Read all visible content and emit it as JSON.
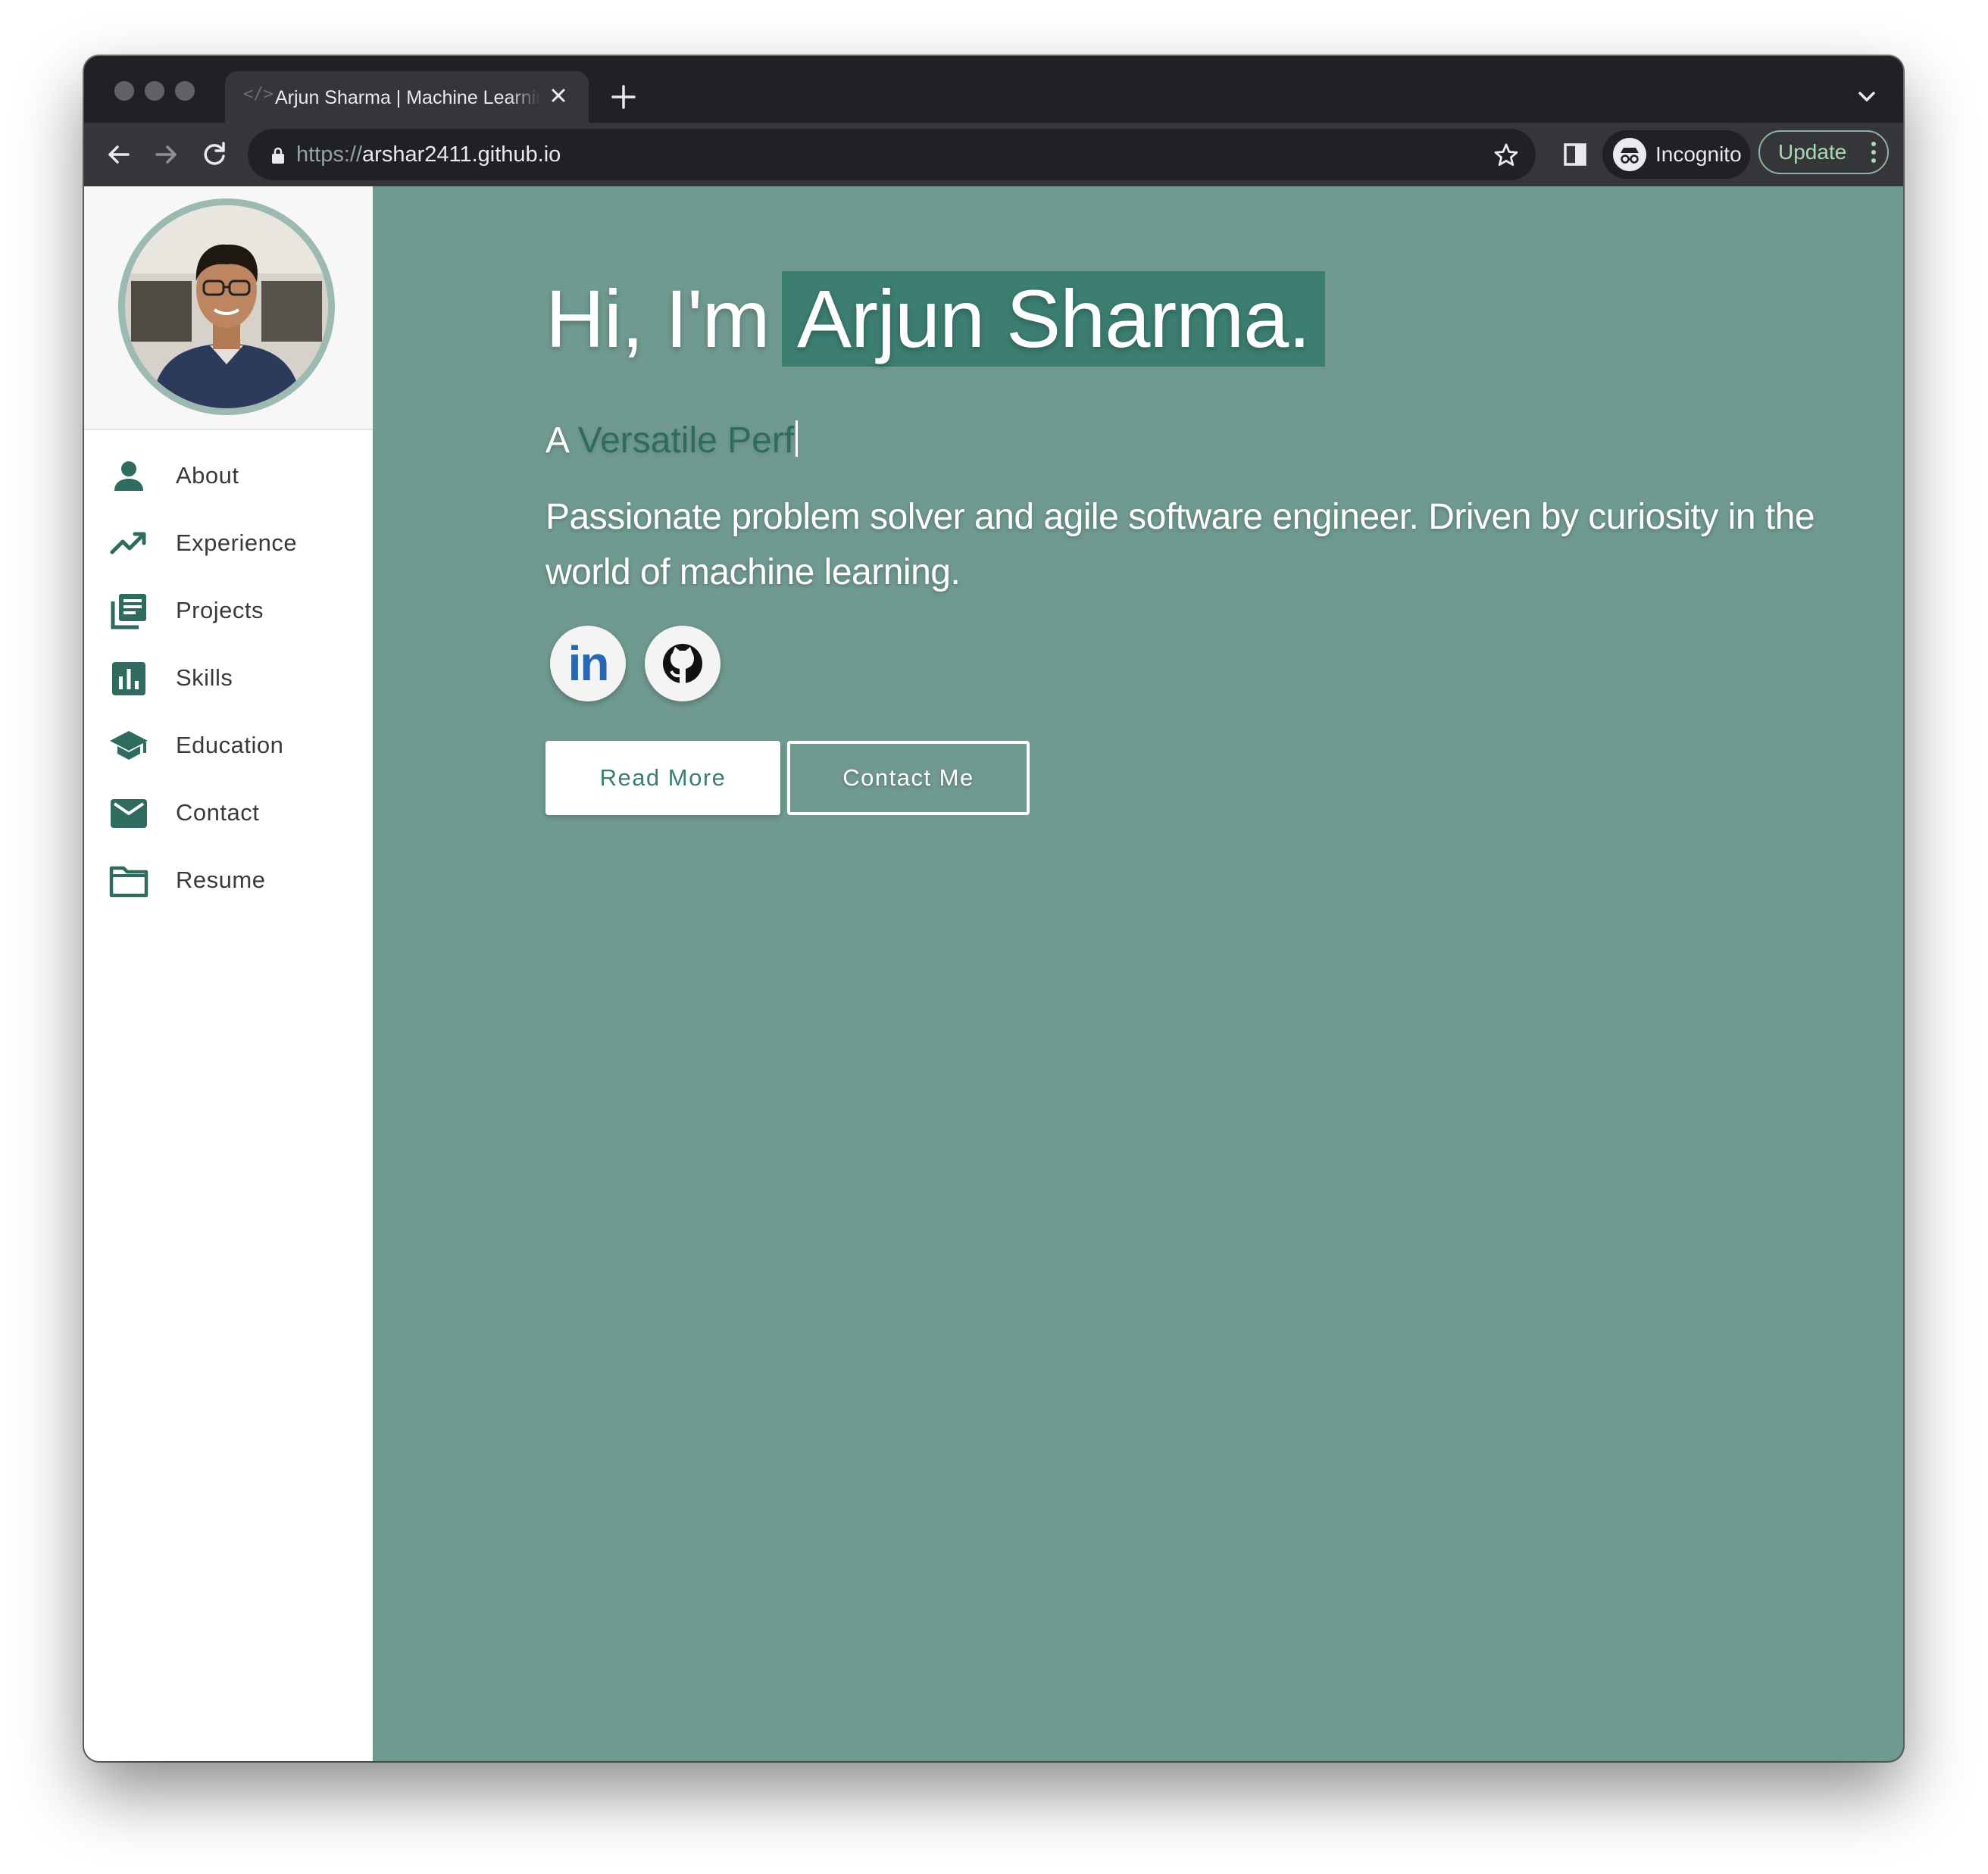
{
  "browser": {
    "tab_title": "Arjun Sharma | Machine Learning",
    "url_scheme": "https://",
    "url_host": "arshar2411.github.io",
    "incognito_label": "Incognito",
    "update_label": "Update"
  },
  "sidebar": {
    "items": [
      {
        "label": "About",
        "icon": "person-icon"
      },
      {
        "label": "Experience",
        "icon": "trending-up-icon"
      },
      {
        "label": "Projects",
        "icon": "library-books-icon"
      },
      {
        "label": "Skills",
        "icon": "bar-chart-icon"
      },
      {
        "label": "Education",
        "icon": "graduation-cap-icon"
      },
      {
        "label": "Contact",
        "icon": "mail-icon"
      },
      {
        "label": "Resume",
        "icon": "folder-icon"
      }
    ]
  },
  "hero": {
    "greeting": "Hi, I'm",
    "name": "Arjun Sharma.",
    "typed_prefix": "A ",
    "typed_word": "Versatile Perf",
    "bio": "Passionate problem solver and agile software engineer. Driven by curiosity in the world of machine learning.",
    "linkedin_label": "in",
    "read_more": "Read More",
    "contact_me": "Contact Me"
  },
  "colors": {
    "accent": "#3c7e71",
    "page_bg": "#709a90",
    "sidebar_icon": "#2f6b5f"
  }
}
